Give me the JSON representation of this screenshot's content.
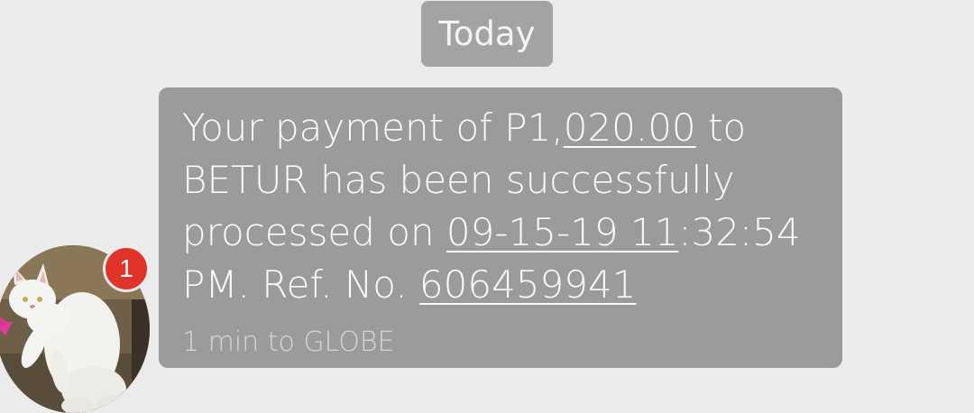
{
  "date_separator": "Today",
  "message": {
    "parts": [
      "Your payment of P1,",
      "020.00",
      " to",
      "BETUR has been successfully",
      "processed on ",
      "09-15-19 11",
      ":32:54",
      "PM. Ref. No. ",
      "606459941"
    ],
    "meta": "1 min to GLOBE"
  },
  "contact": {
    "avatar_icon": "cat-photo-avatar",
    "unread_badge": "1"
  },
  "colors": {
    "background": "#ebebeb",
    "bubble": "#9b9b9b",
    "date_pill": "#a3a3a3",
    "badge": "#e0332b"
  }
}
